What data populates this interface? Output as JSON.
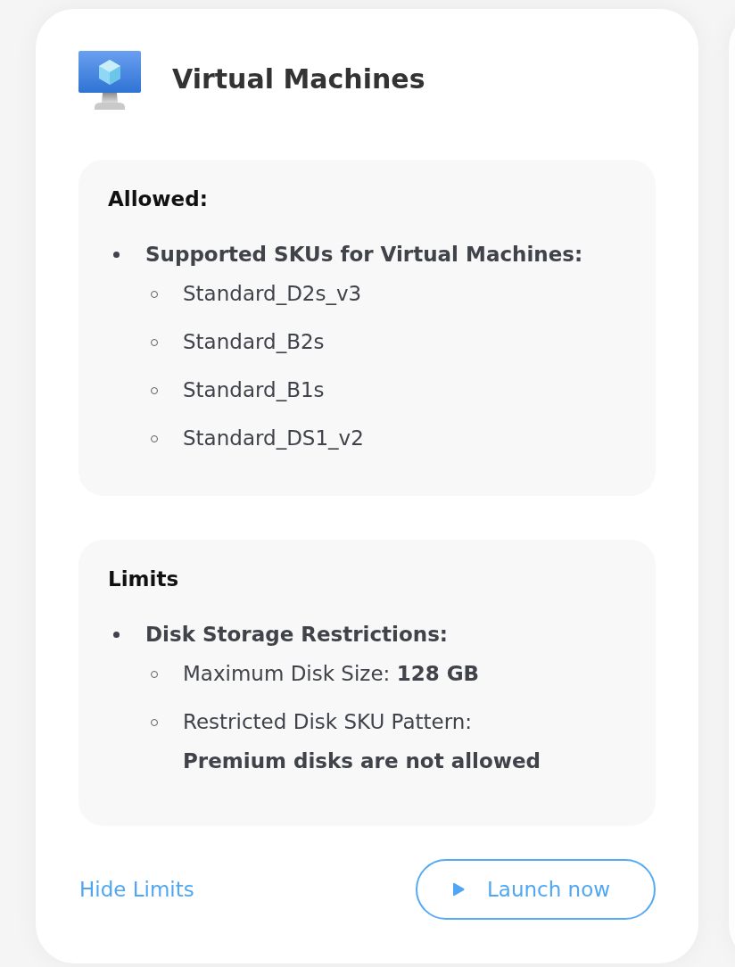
{
  "card": {
    "title": "Virtual Machines",
    "sections": [
      {
        "heading": "Allowed:",
        "groups": [
          {
            "title": "Supported SKUs for Virtual Machines:",
            "items": [
              {
                "kind": "plain",
                "label": "Standard_D2s_v3"
              },
              {
                "kind": "plain",
                "label": "Standard_B2s"
              },
              {
                "kind": "plain",
                "label": "Standard_B1s"
              },
              {
                "kind": "plain",
                "label": "Standard_DS1_v2"
              }
            ]
          }
        ]
      },
      {
        "heading": "Limits",
        "groups": [
          {
            "title": "Disk Storage Restrictions:",
            "items": [
              {
                "kind": "inline",
                "label": "Maximum Disk Size:",
                "value": "128 GB"
              },
              {
                "kind": "stacked",
                "label": "Restricted Disk SKU Pattern:",
                "value": "Premium disks are not allowed"
              }
            ]
          }
        ]
      }
    ],
    "link": "Hide Limits",
    "button": "Launch now"
  }
}
